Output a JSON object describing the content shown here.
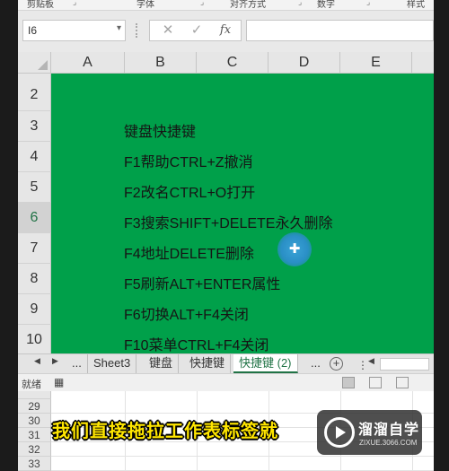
{
  "ribbon": {
    "groups": [
      "剪贴板",
      "字体",
      "对齐方式",
      "数字",
      "样式"
    ]
  },
  "formula_bar": {
    "name_box": "I6",
    "cancel_glyph": "✕",
    "enter_glyph": "✓",
    "fx_label": "fx",
    "content": ""
  },
  "columns": [
    "A",
    "B",
    "C",
    "D",
    "E"
  ],
  "rows": [
    "2",
    "3",
    "4",
    "5",
    "6",
    "7",
    "8",
    "9",
    "10"
  ],
  "selected_row": "6",
  "cells": [
    "键盘快捷键",
    "F1帮助CTRL+Z撤消",
    "F2改名CTRL+O打开",
    "F3搜索SHIFT+DELETE永久删除",
    "F4地址DELETE删除",
    "F5刷新ALT+ENTER属性",
    "F6切换ALT+F4关闭",
    "F10菜单CTRL+F4关闭"
  ],
  "sheet_tabs": {
    "ellipsis_left": "...",
    "tabs": [
      "Sheet3",
      "键盘",
      "快捷键",
      "快捷键 (2)"
    ],
    "active": "快捷键 (2)",
    "ellipsis_right": "...",
    "add": "+"
  },
  "status": {
    "ready": "就绪"
  },
  "second_window_rows": [
    "29",
    "30",
    "31",
    "32",
    "33"
  ],
  "subtitle": "我们直接拖拉工作表标签就",
  "watermark": {
    "brand": "溜溜自学",
    "url": "ZIXUE.3066.COM"
  },
  "colors": {
    "fill_green": "#00a04a",
    "excel_green": "#217346",
    "subtitle_yellow": "#ffe600",
    "cursor_blue": "#2a8fc6"
  }
}
